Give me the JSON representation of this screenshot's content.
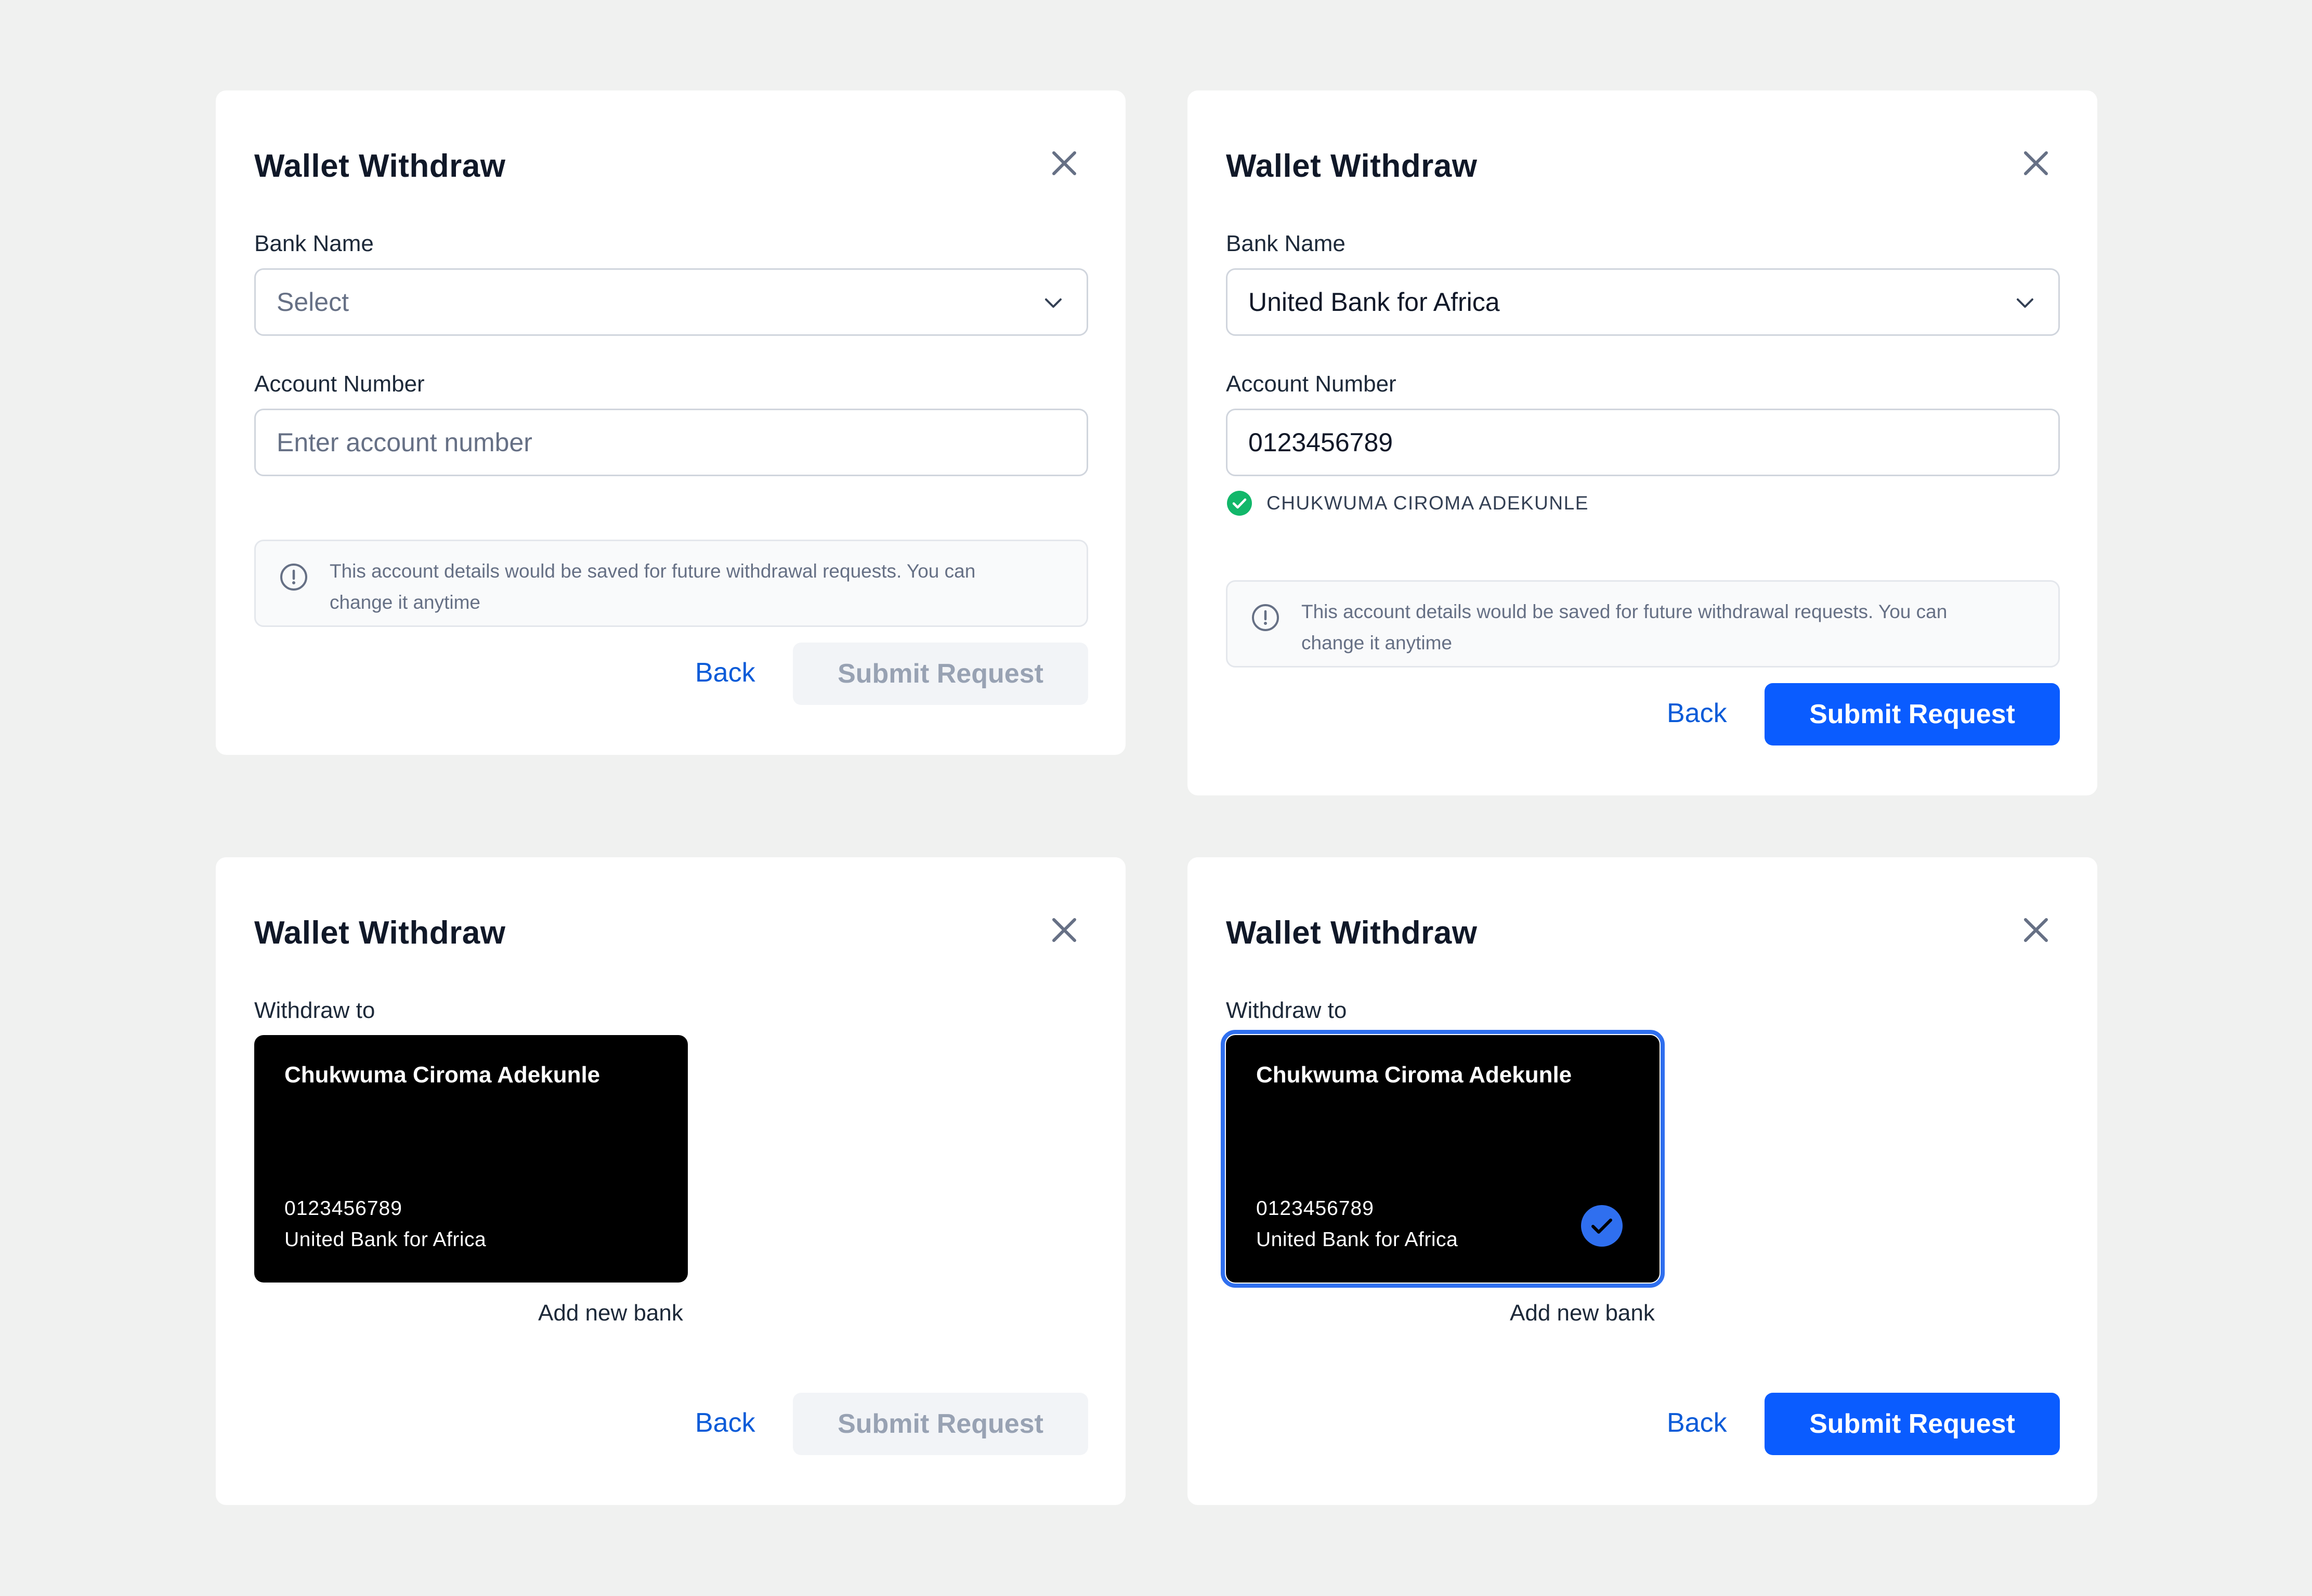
{
  "colors": {
    "page_background": "#f0f1f0",
    "primary": "#0a5cff",
    "link": "#0a5bd8",
    "disabled_bg": "#f2f4f7",
    "disabled_text": "#98a2b3",
    "success": "#12b76a",
    "card_background": "#000000",
    "selected_border": "#2f6fef"
  },
  "modals": [
    {
      "title": "Wallet Withdraw",
      "bank_label": "Bank Name",
      "bank_placeholder": "Select",
      "account_label": "Account Number",
      "account_placeholder": "Enter account number",
      "info_text": "This account details would be saved for future withdrawal requests. You can change it anytime",
      "back_label": "Back",
      "submit_label": "Submit Request",
      "submit_state": "disabled"
    },
    {
      "title": "Wallet Withdraw",
      "bank_label": "Bank Name",
      "bank_value": "United Bank for Africa",
      "account_label": "Account Number",
      "account_value": "0123456789",
      "verified_name": "CHUKWUMA CIROMA ADEKUNLE",
      "info_text": "This account details would be saved for future withdrawal requests. You can change it anytime",
      "back_label": "Back",
      "submit_label": "Submit Request",
      "submit_state": "active"
    },
    {
      "title": "Wallet Withdraw",
      "withdraw_label": "Withdraw to",
      "card": {
        "name": "Chukwuma Ciroma Adekunle",
        "account": "0123456789",
        "bank": "United Bank for Africa",
        "selected": false
      },
      "add_bank_label": "Add new bank",
      "back_label": "Back",
      "submit_label": "Submit Request",
      "submit_state": "disabled"
    },
    {
      "title": "Wallet Withdraw",
      "withdraw_label": "Withdraw to",
      "card": {
        "name": "Chukwuma Ciroma Adekunle",
        "account": "0123456789",
        "bank": "United Bank for Africa",
        "selected": true
      },
      "add_bank_label": "Add new bank",
      "back_label": "Back",
      "submit_label": "Submit Request",
      "submit_state": "active"
    }
  ]
}
